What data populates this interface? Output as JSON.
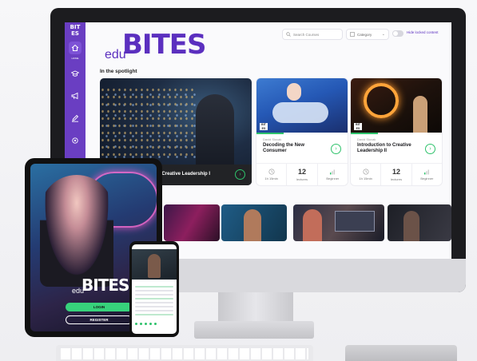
{
  "desktop": {
    "sidebar": {
      "logo_text": "BIT ES",
      "items": [
        {
          "icon": "home-icon",
          "label": "HOME"
        },
        {
          "icon": "graduation-cap-icon",
          "label": ""
        },
        {
          "icon": "megaphone-icon",
          "label": ""
        },
        {
          "icon": "pencil-icon",
          "label": ""
        },
        {
          "icon": "settings-icon",
          "label": ""
        }
      ]
    },
    "brand": {
      "prefix": "edu",
      "name": "BITES"
    },
    "search": {
      "placeholder": "Search Courses"
    },
    "category": {
      "label": "Category"
    },
    "hide_locked_label": "Hide locked content",
    "spotlight_title": "In the spotlight",
    "hero": {
      "title": "to Creative Leadership I"
    },
    "courses": [
      {
        "author": "David Slovak",
        "title": "Decoding the New Consumer",
        "duration": "1h 15min",
        "lectures_count": "12",
        "lectures_label": "lectures",
        "level": "Beginner",
        "badge": "BIT ES"
      },
      {
        "author": "David Slovak",
        "title": "Introduction to Creative Leadership II",
        "duration": "1h 15min",
        "lectures_count": "12",
        "lectures_label": "lectures",
        "level": "Beginner",
        "badge": "BIT ES"
      }
    ]
  },
  "tablet": {
    "brand": {
      "prefix": "edu",
      "name": "BITES"
    },
    "login_label": "LOGIN",
    "register_label": "REGISTER"
  },
  "colors": {
    "brand_purple": "#5b2fbf",
    "sidebar_purple": "#6a3ec2",
    "accent_green": "#2ec26b"
  }
}
